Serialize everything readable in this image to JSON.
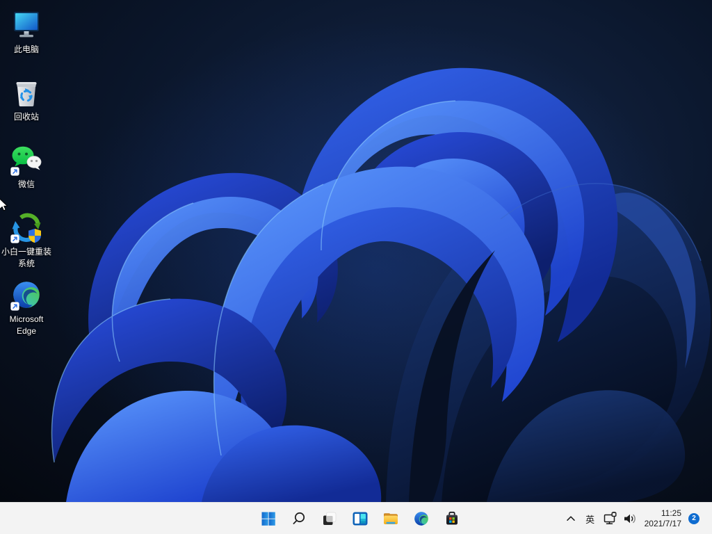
{
  "desktop": {
    "wallpaper": "windows-11-bloom-dark",
    "icons": [
      {
        "id": "this-pc",
        "label": "此电脑",
        "lines": [
          "此电脑"
        ]
      },
      {
        "id": "recycle-bin",
        "label": "回收站",
        "lines": [
          "回收站"
        ]
      },
      {
        "id": "wechat",
        "label": "微信",
        "lines": [
          "微信"
        ]
      },
      {
        "id": "xiaobai-reinstall",
        "label": "小白一键重装系统",
        "lines": [
          "小白一键重装",
          "系统"
        ]
      },
      {
        "id": "microsoft-edge",
        "label": "Microsoft Edge",
        "lines": [
          "Microsoft",
          "Edge"
        ]
      }
    ]
  },
  "taskbar": {
    "buttons": [
      "start",
      "search",
      "task-view",
      "widgets",
      "file-explorer",
      "edge",
      "microsoft-store"
    ],
    "tray": {
      "ime": "英",
      "time": "11:25",
      "date": "2021/7/17",
      "notification_count": "2"
    }
  },
  "colors": {
    "accent": "#0f6cd0",
    "taskbar_bg": "#f3f3f3",
    "badge_bg": "#0f6cd0",
    "desktop_label": "#ffffff"
  }
}
